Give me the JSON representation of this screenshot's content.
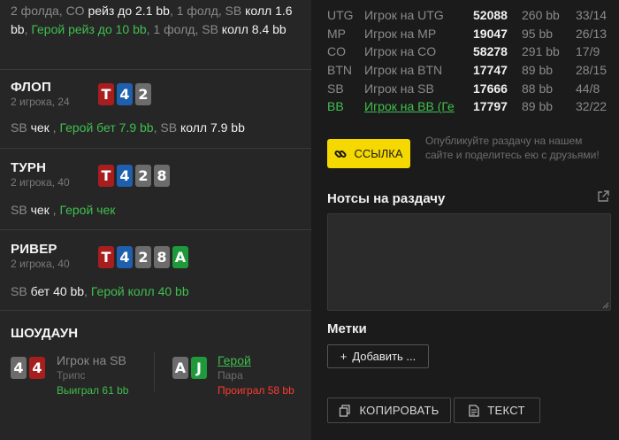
{
  "preflop": {
    "parts": [
      {
        "t": "2 фолда, CO ",
        "c": "grey"
      },
      {
        "t": "рейз до 2.1 bb",
        "c": "white"
      },
      {
        "t": ", 1 фолд, SB ",
        "c": "grey"
      },
      {
        "t": "колл 1.6 bb",
        "c": "white"
      },
      {
        "t": ", ",
        "c": "grey"
      },
      {
        "t": "Герой рейз до 10 bb",
        "c": "green"
      },
      {
        "t": ", 1 фолд, SB ",
        "c": "grey"
      },
      {
        "t": "колл 8.4 bb",
        "c": "white"
      }
    ]
  },
  "streets": {
    "flop": {
      "title": "ФЛОП",
      "sub": "2 игрока, 24",
      "cards": [
        {
          "rank": "T",
          "color": "red"
        },
        {
          "rank": "4",
          "color": "blue"
        },
        {
          "rank": "2",
          "color": "grey"
        }
      ],
      "action": [
        {
          "t": "SB ",
          "c": "grey"
        },
        {
          "t": "чек",
          "c": "white"
        },
        {
          "t": " , ",
          "c": "grey"
        },
        {
          "t": "Герой бет 7.9 bb",
          "c": "green"
        },
        {
          "t": ", SB ",
          "c": "grey"
        },
        {
          "t": "колл 7.9 bb",
          "c": "white"
        }
      ]
    },
    "turn": {
      "title": "ТУРН",
      "sub": "2 игрока, 40",
      "cards": [
        {
          "rank": "T",
          "color": "red"
        },
        {
          "rank": "4",
          "color": "blue"
        },
        {
          "rank": "2",
          "color": "grey"
        },
        {
          "rank": "8",
          "color": "grey"
        }
      ],
      "action": [
        {
          "t": "SB ",
          "c": "grey"
        },
        {
          "t": "чек",
          "c": "white"
        },
        {
          "t": " , ",
          "c": "grey"
        },
        {
          "t": "Герой",
          "c": "green"
        },
        {
          "t": " чек",
          "c": "green"
        }
      ]
    },
    "river": {
      "title": "РИВЕР",
      "sub": "2 игрока, 40",
      "cards": [
        {
          "rank": "T",
          "color": "red"
        },
        {
          "rank": "4",
          "color": "blue"
        },
        {
          "rank": "2",
          "color": "grey"
        },
        {
          "rank": "8",
          "color": "grey"
        },
        {
          "rank": "A",
          "color": "green"
        }
      ],
      "action": [
        {
          "t": "SB ",
          "c": "grey"
        },
        {
          "t": "бет 40 bb",
          "c": "white"
        },
        {
          "t": ", ",
          "c": "grey"
        },
        {
          "t": "Герой колл 40 bb",
          "c": "green"
        }
      ]
    }
  },
  "showdown": {
    "title": "ШОУДАУН",
    "villain": {
      "cards": [
        {
          "rank": "4",
          "color": "grey"
        },
        {
          "rank": "4",
          "color": "red"
        }
      ],
      "name": "Игрок на SB",
      "hand": "Трипс",
      "result": "Выиграл 61 bb"
    },
    "hero": {
      "cards": [
        {
          "rank": "A",
          "color": "grey"
        },
        {
          "rank": "J",
          "color": "green"
        }
      ],
      "name": "Герой",
      "hand": "Пара",
      "result": "Проиграл 58 bb"
    }
  },
  "players": [
    {
      "pos": "UTG",
      "name": "Игрок на UTG",
      "id": "52088",
      "stack": "260 bb",
      "stat": "33/14",
      "hero": false
    },
    {
      "pos": "MP",
      "name": "Игрок на MP",
      "id": "19047",
      "stack": "95 bb",
      "stat": "26/13",
      "hero": false
    },
    {
      "pos": "CO",
      "name": "Игрок на CO",
      "id": "58278",
      "stack": "291 bb",
      "stat": "17/9",
      "hero": false
    },
    {
      "pos": "BTN",
      "name": "Игрок на BTN",
      "id": "17747",
      "stack": "89 bb",
      "stat": "28/15",
      "hero": false
    },
    {
      "pos": "SB",
      "name": "Игрок на SB",
      "id": "17666",
      "stack": "88 bb",
      "stat": "44/8",
      "hero": false
    },
    {
      "pos": "BB",
      "name": "Игрок на BB (Ге",
      "id": "17797",
      "stack": "89 bb",
      "stat": "32/22",
      "hero": true
    }
  ],
  "share": {
    "button_label": "ССЫЛКА",
    "text": "Опубликуйте раздачу на нашем сайте и поделитесь ею с друзьями!"
  },
  "notes": {
    "title": "Нотсы на раздачу",
    "value": ""
  },
  "tags": {
    "title": "Метки",
    "add_label": "Добавить ...",
    "add_plus": "+"
  },
  "buttons": {
    "copy_label": "КОПИРОВАТЬ",
    "text_label": "ТЕКСТ"
  },
  "colors": {
    "card_red": "#a81e1e",
    "card_blue": "#1e5fae",
    "card_grey": "#6c6c6c",
    "card_green": "#1f9a3a",
    "accent_yellow": "#f5d800",
    "hero_green": "#3fbf4f",
    "loss_red": "#ff3b30"
  }
}
